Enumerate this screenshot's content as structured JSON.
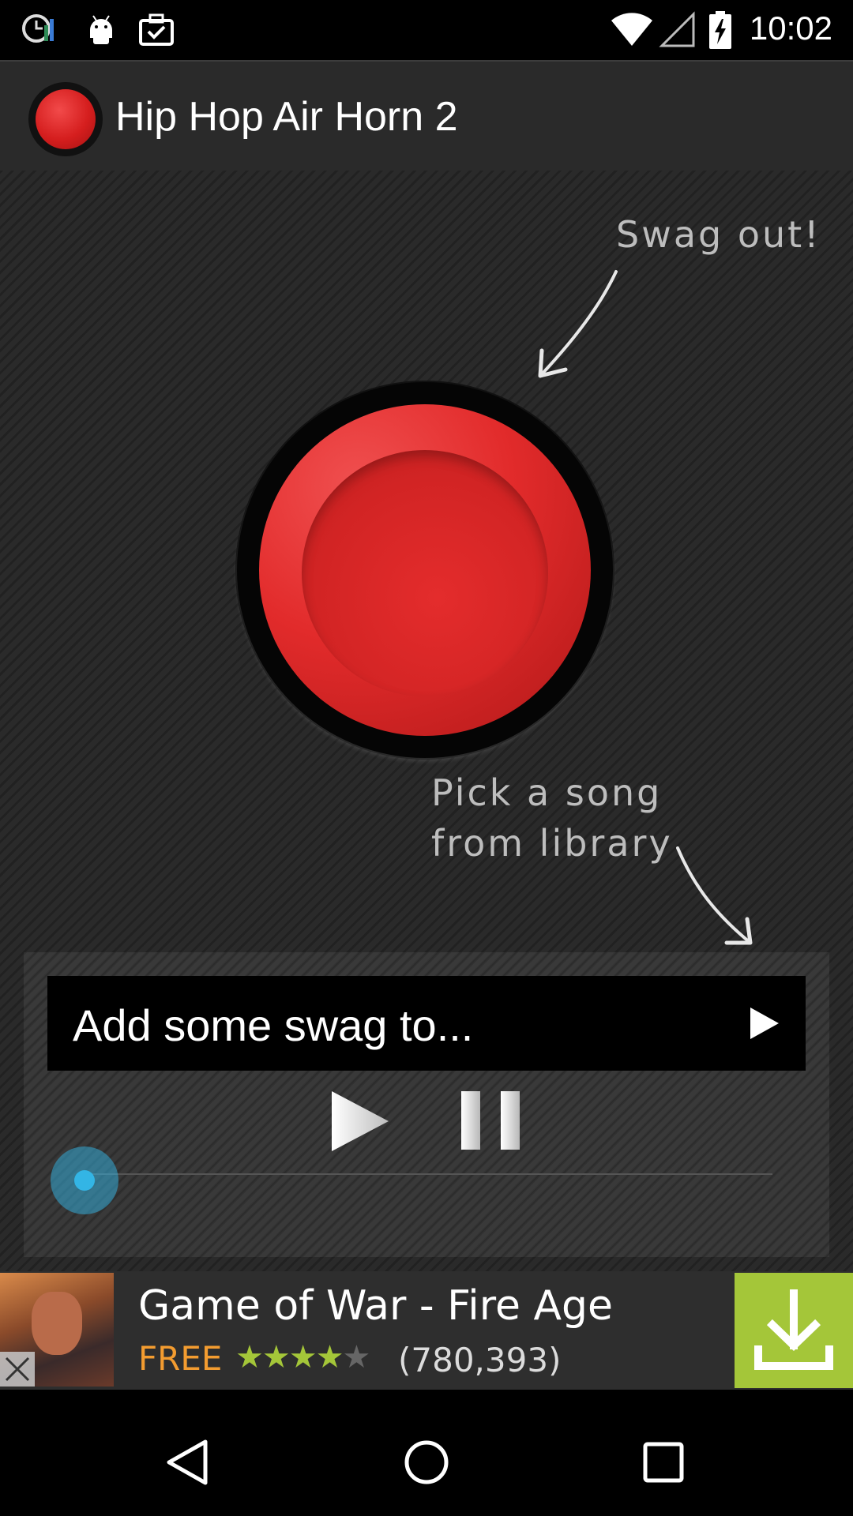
{
  "status_bar": {
    "time": "10:02",
    "icons": [
      "clock-chart-icon",
      "android-icon",
      "briefcase-check-icon",
      "wifi-icon",
      "signal-icon",
      "battery-charging-icon"
    ]
  },
  "action_bar": {
    "title": "Hip Hop Air Horn 2",
    "logo_icon": "red-button-icon"
  },
  "main": {
    "hint_top": "Swag out!",
    "hint_bottom_line1": "Pick a song",
    "hint_bottom_line2": "from library",
    "horn_button_color": "#e22b2b"
  },
  "player": {
    "song_picker_label": "Add some swag to...",
    "play_icon": "play-icon",
    "pause_icon": "pause-icon",
    "seek_accent": "#33b5e5",
    "seek_progress": 0
  },
  "ad": {
    "title": "Game of War - Fire Age",
    "price": "FREE",
    "rating": 4,
    "rating_max": 5,
    "review_count": "(780,393)",
    "download_color": "#a4c639",
    "price_color": "#f39c30"
  },
  "nav_bar": {
    "buttons": [
      "back-icon",
      "home-icon",
      "recents-icon"
    ]
  }
}
